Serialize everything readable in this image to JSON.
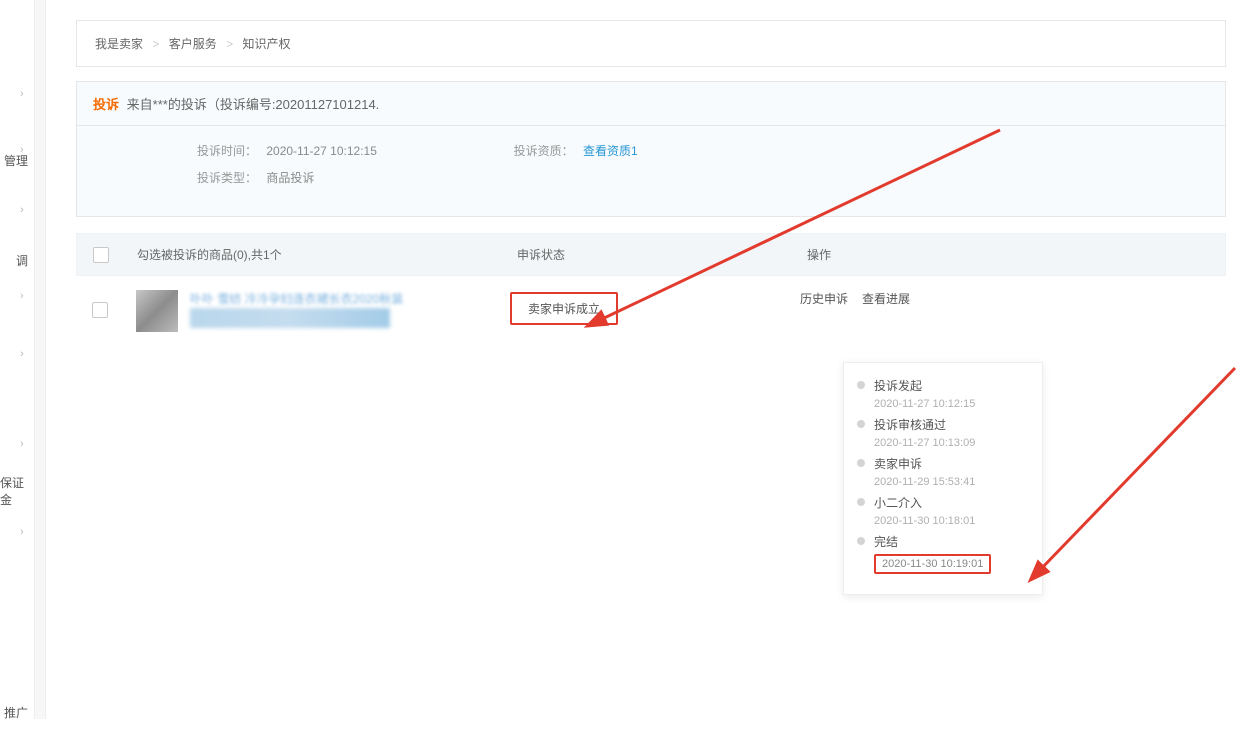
{
  "sidebar": {
    "items": [
      "",
      "管理",
      "",
      "调",
      "",
      "",
      "",
      "保证金",
      ""
    ],
    "promo": "推广"
  },
  "breadcrumb": {
    "a": "我是卖家",
    "b": "客户服务",
    "c": "知识产权"
  },
  "complaint": {
    "tag": "投诉",
    "title": "来自***的投诉（投诉编号:20201127101214.",
    "time_label": "投诉时间：",
    "time_value": "2020-11-27 10:12:15",
    "qual_label": "投诉资质：",
    "qual_link": "查看资质1",
    "type_label": "投诉类型：",
    "type_value": "商品投诉"
  },
  "table": {
    "col_prod": "勾选被投诉的商品(0),共1个",
    "col_status": "申诉状态",
    "col_action": "操作"
  },
  "row": {
    "prod_blurred": "卟卟 雪纺 冷冷孕妇连衣裙长衣2020秋装",
    "status": "卖家申诉成立",
    "action_history": "历史申诉",
    "action_progress": "查看进展"
  },
  "timeline": [
    {
      "title": "投诉发起",
      "time": "2020-11-27 10:12:15",
      "hl": false
    },
    {
      "title": "投诉审核通过",
      "time": "2020-11-27 10:13:09",
      "hl": false
    },
    {
      "title": "卖家申诉",
      "time": "2020-11-29 15:53:41",
      "hl": false
    },
    {
      "title": "小二介入",
      "time": "2020-11-30 10:18:01",
      "hl": false
    },
    {
      "title": "完结",
      "time": "2020-11-30 10:19:01",
      "hl": true
    }
  ]
}
